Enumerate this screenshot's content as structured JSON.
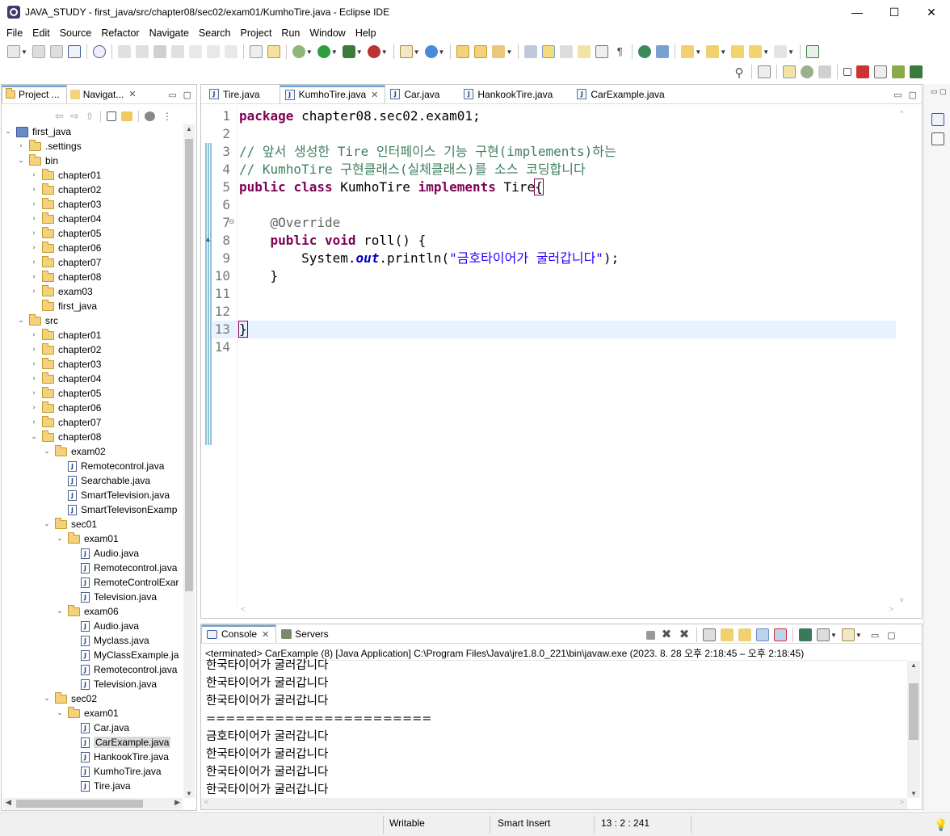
{
  "window": {
    "title": "JAVA_STUDY - first_java/src/chapter08/sec02/exam01/KumhoTire.java - Eclipse IDE",
    "minimize": "—",
    "maximize": "☐",
    "close": "✕"
  },
  "menu": [
    "File",
    "Edit",
    "Source",
    "Refactor",
    "Navigate",
    "Search",
    "Project",
    "Run",
    "Window",
    "Help"
  ],
  "left_panel": {
    "tabs": [
      "Project ...",
      "Navigat..."
    ],
    "close_glyph": "✕",
    "tree": [
      {
        "depth": 0,
        "type": "project",
        "label": "first_java",
        "expanded": true
      },
      {
        "depth": 1,
        "type": "folder",
        "label": ".settings",
        "expanded": false
      },
      {
        "depth": 1,
        "type": "folder",
        "label": "bin",
        "expanded": true
      },
      {
        "depth": 2,
        "type": "folder",
        "label": "chapter01",
        "expanded": false
      },
      {
        "depth": 2,
        "type": "folder",
        "label": "chapter02",
        "expanded": false
      },
      {
        "depth": 2,
        "type": "folder",
        "label": "chapter03",
        "expanded": false
      },
      {
        "depth": 2,
        "type": "folder",
        "label": "chapter04",
        "expanded": false
      },
      {
        "depth": 2,
        "type": "folder",
        "label": "chapter05",
        "expanded": false
      },
      {
        "depth": 2,
        "type": "folder",
        "label": "chapter06",
        "expanded": false
      },
      {
        "depth": 2,
        "type": "folder",
        "label": "chapter07",
        "expanded": false
      },
      {
        "depth": 2,
        "type": "folder",
        "label": "chapter08",
        "expanded": false
      },
      {
        "depth": 2,
        "type": "folder",
        "label": "exam03",
        "expanded": false
      },
      {
        "depth": 2,
        "type": "folder",
        "label": "first_java",
        "expanded": null
      },
      {
        "depth": 1,
        "type": "folder",
        "label": "src",
        "expanded": true
      },
      {
        "depth": 2,
        "type": "folder",
        "label": "chapter01",
        "expanded": false
      },
      {
        "depth": 2,
        "type": "folder",
        "label": "chapter02",
        "expanded": false
      },
      {
        "depth": 2,
        "type": "folder",
        "label": "chapter03",
        "expanded": false
      },
      {
        "depth": 2,
        "type": "folder",
        "label": "chapter04",
        "expanded": false
      },
      {
        "depth": 2,
        "type": "folder",
        "label": "chapter05",
        "expanded": false
      },
      {
        "depth": 2,
        "type": "folder",
        "label": "chapter06",
        "expanded": false
      },
      {
        "depth": 2,
        "type": "folder",
        "label": "chapter07",
        "expanded": false
      },
      {
        "depth": 2,
        "type": "folder",
        "label": "chapter08",
        "expanded": true
      },
      {
        "depth": 3,
        "type": "folder",
        "label": "exam02",
        "expanded": true
      },
      {
        "depth": 4,
        "type": "java",
        "label": "Remotecontrol.java"
      },
      {
        "depth": 4,
        "type": "java",
        "label": "Searchable.java"
      },
      {
        "depth": 4,
        "type": "java",
        "label": "SmartTelevision.java"
      },
      {
        "depth": 4,
        "type": "java",
        "label": "SmartTelevisonExamp"
      },
      {
        "depth": 3,
        "type": "folder",
        "label": "sec01",
        "expanded": true
      },
      {
        "depth": 4,
        "type": "folder",
        "label": "exam01",
        "expanded": true
      },
      {
        "depth": 5,
        "type": "java",
        "label": "Audio.java"
      },
      {
        "depth": 5,
        "type": "java",
        "label": "Remotecontrol.java"
      },
      {
        "depth": 5,
        "type": "java",
        "label": "RemoteControlExar"
      },
      {
        "depth": 5,
        "type": "java",
        "label": "Television.java"
      },
      {
        "depth": 4,
        "type": "folder",
        "label": "exam06",
        "expanded": true
      },
      {
        "depth": 5,
        "type": "java",
        "label": "Audio.java"
      },
      {
        "depth": 5,
        "type": "java",
        "label": "Myclass.java"
      },
      {
        "depth": 5,
        "type": "java",
        "label": "MyClassExample.ja"
      },
      {
        "depth": 5,
        "type": "java",
        "label": "Remotecontrol.java"
      },
      {
        "depth": 5,
        "type": "java",
        "label": "Television.java"
      },
      {
        "depth": 3,
        "type": "folder",
        "label": "sec02",
        "expanded": true
      },
      {
        "depth": 4,
        "type": "folder",
        "label": "exam01",
        "expanded": true
      },
      {
        "depth": 5,
        "type": "java",
        "label": "Car.java"
      },
      {
        "depth": 5,
        "type": "java",
        "label": "CarExample.java",
        "selected": true
      },
      {
        "depth": 5,
        "type": "java",
        "label": "HankookTire.java"
      },
      {
        "depth": 5,
        "type": "java",
        "label": "KumhoTire.java"
      },
      {
        "depth": 5,
        "type": "java",
        "label": "Tire.java"
      }
    ]
  },
  "editor": {
    "tabs": [
      {
        "label": "Tire.java",
        "active": false
      },
      {
        "label": "KumhoTire.java",
        "active": true
      },
      {
        "label": "Car.java",
        "active": false
      },
      {
        "label": "HankookTire.java",
        "active": false
      },
      {
        "label": "CarExample.java",
        "active": false
      }
    ],
    "lines": [
      {
        "n": "1",
        "parts": [
          [
            "kw",
            "package"
          ],
          [
            "",
            " chapter08.sec02.exam01;"
          ]
        ]
      },
      {
        "n": "2",
        "parts": []
      },
      {
        "n": "3",
        "parts": [
          [
            "cm",
            "// 앞서 생성한 Tire 인터페이스 기능 구현(implements)하는"
          ]
        ]
      },
      {
        "n": "4",
        "parts": [
          [
            "cm",
            "// KumhoTire 구현클래스(실체클래스)를 소스 코딩합니다"
          ]
        ]
      },
      {
        "n": "5",
        "parts": [
          [
            "kw",
            "public"
          ],
          [
            "",
            " "
          ],
          [
            "kw",
            "class"
          ],
          [
            "",
            " KumhoTire "
          ],
          [
            "kw",
            "implements"
          ],
          [
            "",
            " Tire"
          ],
          [
            "caret",
            "{"
          ]
        ]
      },
      {
        "n": "6",
        "parts": []
      },
      {
        "n": "7",
        "parts": [
          [
            "",
            "    "
          ],
          [
            "an",
            "@Override"
          ]
        ]
      },
      {
        "n": "8",
        "parts": [
          [
            "",
            "    "
          ],
          [
            "kw",
            "public"
          ],
          [
            "",
            " "
          ],
          [
            "kw",
            "void"
          ],
          [
            "",
            " roll() {"
          ]
        ]
      },
      {
        "n": "9",
        "parts": [
          [
            "",
            "        System."
          ],
          [
            "fld",
            "out"
          ],
          [
            "",
            ".println("
          ],
          [
            "st",
            "\"금호타이어가 굴러갑니다\""
          ],
          [
            "",
            ");"
          ]
        ]
      },
      {
        "n": "10",
        "parts": [
          [
            "",
            "    }"
          ]
        ]
      },
      {
        "n": "11",
        "parts": []
      },
      {
        "n": "12",
        "parts": []
      },
      {
        "n": "13",
        "parts": [
          [
            "caret",
            "}"
          ]
        ],
        "current": true
      },
      {
        "n": "14",
        "parts": []
      }
    ]
  },
  "console": {
    "tabs": [
      "Console",
      "Servers"
    ],
    "header": "<terminated> CarExample (8) [Java Application] C:\\Program Files\\Java\\jre1.8.0_221\\bin\\javaw.exe  (2023. 8. 28 오후 2:18:45 – 오후 2:18:45)",
    "lines": [
      "한국타이어가 굴러갑니다",
      "한국타이어가 굴러갑니다",
      "한국타이어가 굴러갑니다",
      "=======================",
      "금호타이어가 굴러갑니다",
      "한국타이어가 굴러갑니다",
      "한국타이어가 굴러갑니다",
      "한국타이어가 굴러갑니다"
    ]
  },
  "status": {
    "writable": "Writable",
    "insert_mode": "Smart Insert",
    "position": "13 : 2 : 241"
  }
}
